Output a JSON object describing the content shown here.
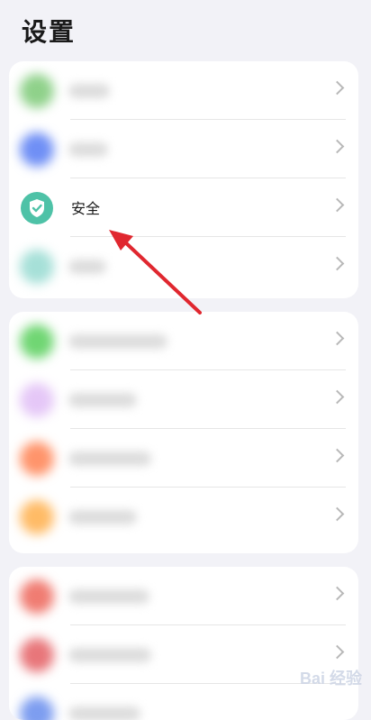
{
  "header": {
    "title": "设置"
  },
  "group1": {
    "rows": [
      {
        "icon_color": "#8fd18a",
        "icon_name": "blurred-green-icon"
      },
      {
        "icon_color": "#6f8ff5",
        "icon_name": "blurred-blue-icon"
      },
      {
        "label": "安全",
        "icon_color": "#4ec2a7",
        "icon_name": "shield-check-icon"
      },
      {
        "icon_color": "#a6e0d8",
        "icon_name": "blurred-teal-icon"
      }
    ]
  },
  "group2": {
    "rows": [
      {
        "icon_color": "#70d673",
        "icon_name": "blurred-green-icon"
      },
      {
        "icon_color": "#e5c7f7",
        "icon_name": "blurred-lavender-icon"
      },
      {
        "icon_color": "#ff946b",
        "icon_name": "blurred-orange-icon"
      },
      {
        "icon_color": "#ffbb66",
        "icon_name": "blurred-yellow-icon"
      }
    ]
  },
  "group3": {
    "rows": [
      {
        "icon_color": "#f07c72",
        "icon_name": "blurred-red-icon"
      },
      {
        "icon_color": "#e8767a",
        "icon_name": "blurred-red-icon"
      },
      {
        "icon_color": "#7d9df0",
        "icon_name": "blurred-blue-icon"
      }
    ]
  },
  "annotation": {
    "color": "#e0272f"
  },
  "watermark": {
    "text": "Bai 经验"
  }
}
